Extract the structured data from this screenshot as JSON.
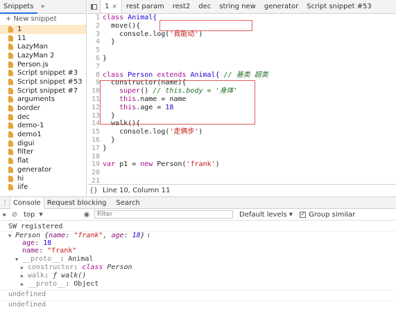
{
  "snippets_panel": {
    "tab_label": "Snippets",
    "more_label": "»",
    "new_snippet_label": "+ New snippet",
    "items": [
      "1",
      "11",
      "LazyMan",
      "LazyMan 2",
      "Person.js",
      "Script snippet #3",
      "Script snippet #53",
      "Script snippet #7",
      "arguments",
      "border",
      "dec",
      "demo-1",
      "demo1",
      "digui",
      "filter",
      "flat",
      "generator",
      "hi",
      "iife"
    ],
    "selected_index": 0
  },
  "editor": {
    "tabs": [
      {
        "label": "1",
        "active": true,
        "close": "×"
      },
      {
        "label": "rest param"
      },
      {
        "label": "rest2"
      },
      {
        "label": "dec"
      },
      {
        "label": "string new"
      },
      {
        "label": "generator"
      },
      {
        "label": "Script snippet #53"
      }
    ],
    "line_numbers": [
      "1",
      "2",
      "3",
      "4",
      "5",
      "6",
      "7",
      "8",
      "9",
      "10",
      "11",
      "12",
      "13",
      "14",
      "15",
      "16",
      "17",
      "18",
      "19",
      "20",
      "21"
    ],
    "status": {
      "format_icon": "{}",
      "cursor": "Line 10, Column 11"
    }
  },
  "code": {
    "l1": {
      "kw": "class",
      "name": " Animal{"
    },
    "l2": "  move(){",
    "l3": {
      "pre": "    console.log(",
      "str": "'我能动'",
      "post": ")"
    },
    "l4": "  }",
    "l5": "",
    "l6": "}",
    "l7": "",
    "l8": {
      "kw": "class",
      "name": " Person ",
      "kw2": "extends",
      "name2": " Animal{ ",
      "cmt": "// 基类 超类"
    },
    "l9": "  constructor(name){",
    "l10": {
      "kw": "    super",
      "pre": "() ",
      "cmt": "// this.body = '身体'"
    },
    "l11": {
      "kw": "    this",
      "pre": ".name = name"
    },
    "l12": {
      "kw": "    this",
      "pre": ".age = ",
      "num": "18"
    },
    "l13": "  }",
    "l14": "  walk(){",
    "l15": {
      "pre": "    console.log(",
      "str": "'走俩步'",
      "post": ")"
    },
    "l16": "  }",
    "l17": "}",
    "l18": "",
    "l19": {
      "kw": "var",
      "pre": " p1 = ",
      "kw2": "new",
      "pre2": " Person(",
      "str": "'frank'",
      "post": ")"
    },
    "l20": "",
    "l21": ""
  },
  "drawer": {
    "menu_icon": "⋮",
    "tabs": [
      "Console",
      "Request blocking",
      "Search"
    ],
    "active_tab": 0
  },
  "console_toolbar": {
    "sidebar_icon": "▸",
    "clear_icon": "⊘",
    "context": "top",
    "context_caret": "▼",
    "eye_icon": "◉",
    "filter_placeholder": "Filter",
    "levels_label": "Default levels",
    "levels_caret": "▼",
    "group_similar_label": "Group similar",
    "group_similar_checked": "✓"
  },
  "console_output": {
    "sw": "SW registered",
    "obj_head_name": "Person",
    "obj_head_body_open": " {",
    "obj_head_key1": "name",
    "obj_head_val1": "\"frank\"",
    "obj_head_key2": "age",
    "obj_head_val2": "18",
    "obj_head_body_close": "}",
    "obj_badge": "ℹ",
    "age_key": "age",
    "age_val": "18",
    "name_key": "name",
    "name_val": "\"frank\"",
    "proto_key": "__proto__",
    "proto_val": "Animal",
    "ctor_key": "constructor",
    "ctor_val_kw": "class",
    "ctor_val_name": " Person",
    "walk_key": "walk",
    "walk_val": "ƒ walk()",
    "proto2_key": "__proto__",
    "proto2_val": "Object",
    "undef1": "undefined",
    "undef2": "undefined",
    "expand_open": "▼",
    "expand_closed": "▶"
  },
  "colors": {
    "highlight_box": "#e05a5a",
    "selected_row": "#fde9c6",
    "file_icon": "#e8a33d",
    "accent": "#1a73e8"
  }
}
